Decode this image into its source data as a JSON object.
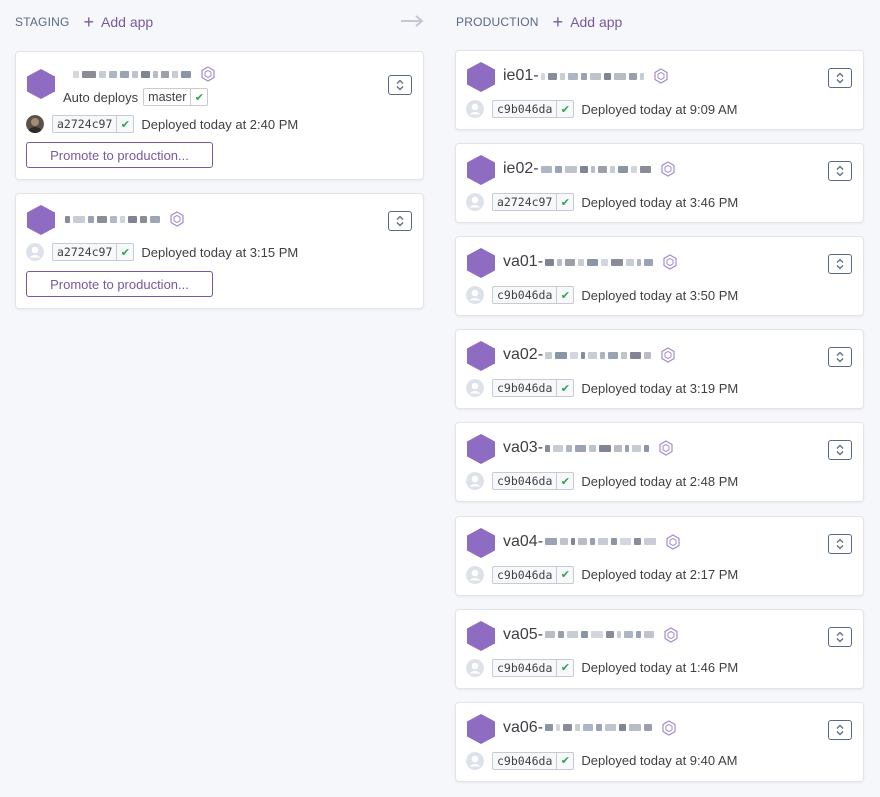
{
  "staging": {
    "title": "STAGING",
    "add_app": "Add app",
    "apps": [
      {
        "auto_deploys_label": "Auto deploys",
        "branch": "master",
        "commit": "a2724c97",
        "deployed": "Deployed today at 2:40 PM",
        "promote_label": "Promote to production..."
      },
      {
        "commit": "a2724c97",
        "deployed": "Deployed today at 3:15 PM",
        "promote_label": "Promote to production..."
      }
    ]
  },
  "production": {
    "title": "PRODUCTION",
    "add_app": "Add app",
    "apps": [
      {
        "name_prefix": "ie01-",
        "commit": "c9b046da",
        "deployed": "Deployed today at 9:09 AM"
      },
      {
        "name_prefix": "ie02-",
        "commit": "a2724c97",
        "deployed": "Deployed today at 3:46 PM"
      },
      {
        "name_prefix": "va01-",
        "commit": "c9b046da",
        "deployed": "Deployed today at 3:50 PM"
      },
      {
        "name_prefix": "va02-",
        "commit": "c9b046da",
        "deployed": "Deployed today at 3:19 PM"
      },
      {
        "name_prefix": "va03-",
        "commit": "c9b046da",
        "deployed": "Deployed today at 2:48 PM"
      },
      {
        "name_prefix": "va04-",
        "commit": "c9b046da",
        "deployed": "Deployed today at 2:17 PM"
      },
      {
        "name_prefix": "va05-",
        "commit": "c9b046da",
        "deployed": "Deployed today at 1:46 PM"
      },
      {
        "name_prefix": "va06-",
        "commit": "c9b046da",
        "deployed": "Deployed today at 9:40 AM"
      }
    ]
  },
  "colors": {
    "accent": "#79589f",
    "app_icon": "#8d6cc2",
    "check": "#2ea44f",
    "heading": "#596981"
  }
}
